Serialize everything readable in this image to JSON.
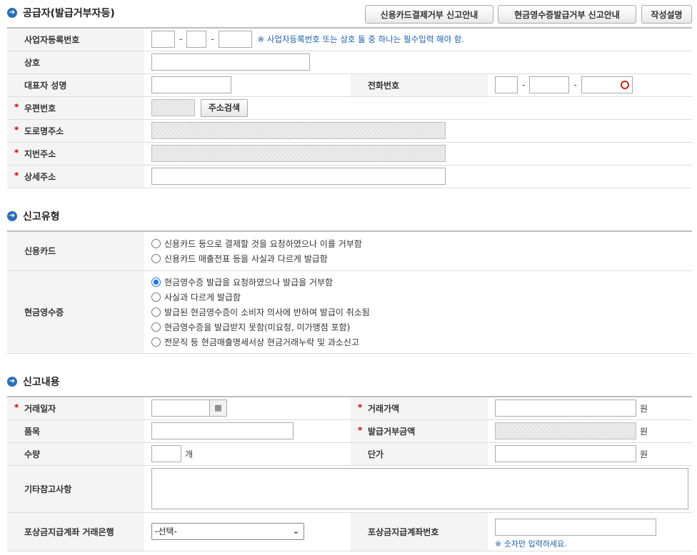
{
  "sections": {
    "supplier": "공급자(발급거부자등)",
    "report_type": "신고유형",
    "report_content": "신고내용"
  },
  "top_buttons": {
    "card_guide": "신용카드결제거부 신고안내",
    "cash_guide": "현금영수증발급거부 신고안내",
    "help": "작성설명"
  },
  "supplier": {
    "biz_no_label": "사업자등록번호",
    "biz_no_note": "※ 사업자등록번호 또는 상호 둘 중 하나는 필수입력 해야 함.",
    "name_label": "상호",
    "rep_label": "대표자 성명",
    "phone_label": "전화번호",
    "zip_label": "우편번호",
    "zip_button": "주소검색",
    "road_label": "도로명주소",
    "jibun_label": "지번주소",
    "detail_label": "상세주소",
    "required_mark": "*",
    "dash": "-"
  },
  "report_type": {
    "card_label": "신용카드",
    "card_options": [
      "신용카드 등으로 결제할 것을 요청하였으나 이를 거부함",
      "신용카드 매출전표 등을 사실과 다르게 발급함"
    ],
    "cash_label": "현금영수증",
    "cash_options": [
      "현금영수증 발급을 요청하였으나 발급을 거부함",
      "사실과 다르게 발급함",
      "발급된 현금영수증이 소비자 의사에 반하여 발급이 취소됨",
      "현금영수증을 발급받지 못함(미요청, 미가맹점 포함)",
      "전문직 등 현금매출명세서상 현금거래누락 및 과소신고"
    ],
    "cash_selected_index": 0
  },
  "report_content": {
    "date_label": "거래일자",
    "amount_label": "거래가액",
    "item_label": "품목",
    "refused_amount_label": "발급거부금액",
    "qty_label": "수량",
    "qty_unit": "개",
    "unit_price_label": "단가",
    "won": "원",
    "etc_label": "기타참고사항",
    "bank_label": "포상금지급계좌 거래은행",
    "bank_selected": "-선택-",
    "account_label": "포상금지급계좌번호",
    "account_note": "※ 숫자만 입력하세요."
  }
}
